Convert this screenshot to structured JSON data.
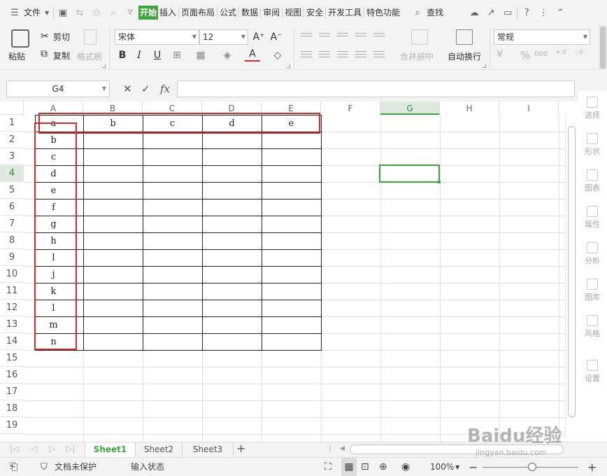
{
  "menubar": {
    "file": "文件",
    "tabs": [
      "开始",
      "插入",
      "页面布局",
      "公式",
      "数据",
      "审阅",
      "视图",
      "安全",
      "开发工具",
      "特色功能"
    ],
    "active_tab": "开始",
    "search": "查找"
  },
  "ribbon": {
    "paste": "粘贴",
    "cut": "剪切",
    "copy": "复制",
    "format_painter": "格式刷",
    "font_name": "宋体",
    "font_size": "12",
    "merge_center": "合并居中",
    "wrap_text": "自动换行",
    "number_format": "常规",
    "percent": "%",
    "thousands": "000"
  },
  "formula_bar": {
    "name_box": "G4",
    "fx": "fx",
    "formula": ""
  },
  "grid": {
    "columns": [
      "A",
      "B",
      "C",
      "D",
      "E",
      "F",
      "G",
      "H",
      "I"
    ],
    "selected_column": "G",
    "rows": [
      "1",
      "2",
      "3",
      "4",
      "5",
      "6",
      "7",
      "8",
      "9",
      "10",
      "11",
      "12",
      "13",
      "14",
      "15",
      "16",
      "17",
      "18",
      "19"
    ],
    "selected_row": "4",
    "row1_values": [
      "a",
      "b",
      "c",
      "d",
      "e"
    ],
    "colA_values": [
      "b",
      "c",
      "d",
      "e",
      "f",
      "g",
      "h",
      "l",
      "j",
      "k",
      "l",
      "m",
      "n"
    ]
  },
  "taskpane": [
    "选择",
    "形状",
    "图表",
    "属性",
    "分析",
    "图库",
    "风格",
    "设置"
  ],
  "sheets": {
    "tabs": [
      "Sheet1",
      "Sheet2",
      "Sheet3"
    ],
    "active": "Sheet1",
    "add": "+"
  },
  "statusbar": {
    "protect": "文档未保护",
    "input_state": "输入状态",
    "zoom": "100%",
    "minus": "−",
    "plus": "+"
  },
  "watermark": "Baidu经验",
  "watermark_sub": "jingyan.baidu.com",
  "colors": {
    "accent": "#3fa63f",
    "annotation": "#d92b2b"
  }
}
